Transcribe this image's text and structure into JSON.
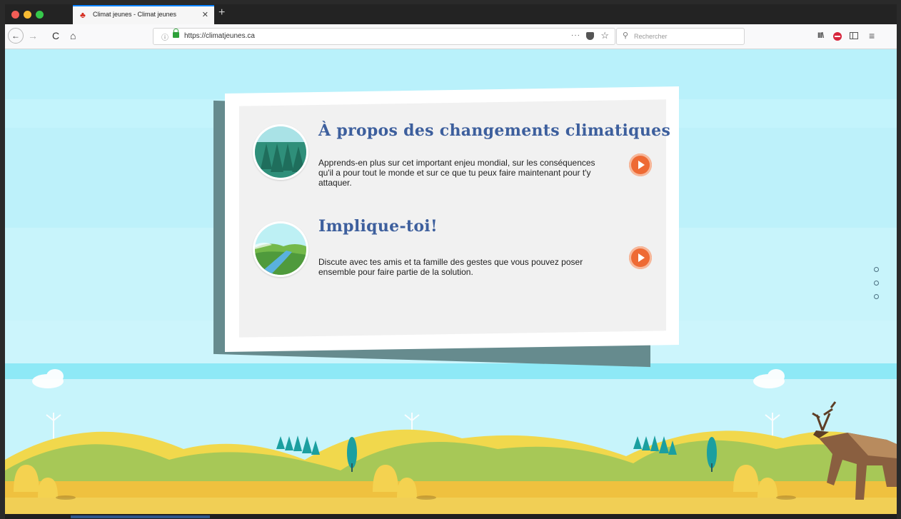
{
  "browser": {
    "tab": {
      "title": "Climat jeunes - Climat jeunes",
      "close": "✕",
      "favicon": "maple-leaf"
    },
    "new_tab": "+",
    "nav": {
      "back": "←",
      "forward": "→",
      "reload": "C",
      "home": "⌂"
    },
    "url": "https://climatjeunes.ca",
    "url_info": "ⓘ",
    "page_actions": "···",
    "bookmark_star": "☆",
    "search_placeholder": "Rechercher",
    "search_icon": "⚲",
    "library": "III\\",
    "menu": "≡"
  },
  "page": {
    "items": [
      {
        "title": "À propos des changements climatiques",
        "text": "Apprends-en plus sur cet important enjeu mondial, sur les conséquences qu'il a pour tout le monde et sur ce que tu peux faire maintenant pour t'y attaquer."
      },
      {
        "title": "Implique-toi!",
        "text": "Discute avec tes amis et ta famille des gestes que vous pouvez poser ensemble pour faire partie de la solution."
      }
    ],
    "section_dots": 3
  },
  "colors": {
    "title": "#3d5f9d",
    "play": "#ee6a34",
    "sky": "#b9f1fb",
    "card_shadow": "#668b8e"
  }
}
